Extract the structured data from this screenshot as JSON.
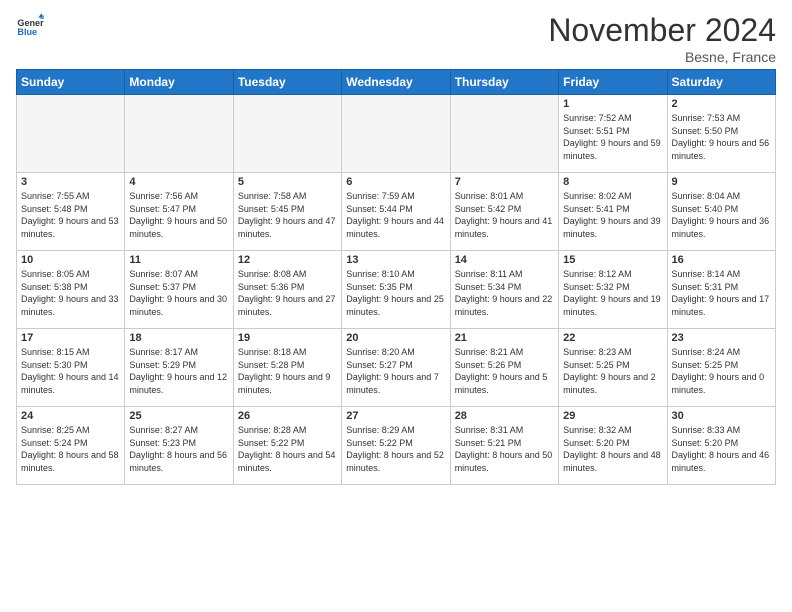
{
  "header": {
    "logo_line1": "General",
    "logo_line2": "Blue",
    "month_title": "November 2024",
    "location": "Besne, France"
  },
  "days_of_week": [
    "Sunday",
    "Monday",
    "Tuesday",
    "Wednesday",
    "Thursday",
    "Friday",
    "Saturday"
  ],
  "weeks": [
    [
      {
        "day": "",
        "empty": true
      },
      {
        "day": "",
        "empty": true
      },
      {
        "day": "",
        "empty": true
      },
      {
        "day": "",
        "empty": true
      },
      {
        "day": "",
        "empty": true
      },
      {
        "day": "1",
        "info": "Sunrise: 7:52 AM\nSunset: 5:51 PM\nDaylight: 9 hours and 59 minutes."
      },
      {
        "day": "2",
        "info": "Sunrise: 7:53 AM\nSunset: 5:50 PM\nDaylight: 9 hours and 56 minutes."
      }
    ],
    [
      {
        "day": "3",
        "info": "Sunrise: 7:55 AM\nSunset: 5:48 PM\nDaylight: 9 hours and 53 minutes."
      },
      {
        "day": "4",
        "info": "Sunrise: 7:56 AM\nSunset: 5:47 PM\nDaylight: 9 hours and 50 minutes."
      },
      {
        "day": "5",
        "info": "Sunrise: 7:58 AM\nSunset: 5:45 PM\nDaylight: 9 hours and 47 minutes."
      },
      {
        "day": "6",
        "info": "Sunrise: 7:59 AM\nSunset: 5:44 PM\nDaylight: 9 hours and 44 minutes."
      },
      {
        "day": "7",
        "info": "Sunrise: 8:01 AM\nSunset: 5:42 PM\nDaylight: 9 hours and 41 minutes."
      },
      {
        "day": "8",
        "info": "Sunrise: 8:02 AM\nSunset: 5:41 PM\nDaylight: 9 hours and 39 minutes."
      },
      {
        "day": "9",
        "info": "Sunrise: 8:04 AM\nSunset: 5:40 PM\nDaylight: 9 hours and 36 minutes."
      }
    ],
    [
      {
        "day": "10",
        "info": "Sunrise: 8:05 AM\nSunset: 5:38 PM\nDaylight: 9 hours and 33 minutes."
      },
      {
        "day": "11",
        "info": "Sunrise: 8:07 AM\nSunset: 5:37 PM\nDaylight: 9 hours and 30 minutes."
      },
      {
        "day": "12",
        "info": "Sunrise: 8:08 AM\nSunset: 5:36 PM\nDaylight: 9 hours and 27 minutes."
      },
      {
        "day": "13",
        "info": "Sunrise: 8:10 AM\nSunset: 5:35 PM\nDaylight: 9 hours and 25 minutes."
      },
      {
        "day": "14",
        "info": "Sunrise: 8:11 AM\nSunset: 5:34 PM\nDaylight: 9 hours and 22 minutes."
      },
      {
        "day": "15",
        "info": "Sunrise: 8:12 AM\nSunset: 5:32 PM\nDaylight: 9 hours and 19 minutes."
      },
      {
        "day": "16",
        "info": "Sunrise: 8:14 AM\nSunset: 5:31 PM\nDaylight: 9 hours and 17 minutes."
      }
    ],
    [
      {
        "day": "17",
        "info": "Sunrise: 8:15 AM\nSunset: 5:30 PM\nDaylight: 9 hours and 14 minutes."
      },
      {
        "day": "18",
        "info": "Sunrise: 8:17 AM\nSunset: 5:29 PM\nDaylight: 9 hours and 12 minutes."
      },
      {
        "day": "19",
        "info": "Sunrise: 8:18 AM\nSunset: 5:28 PM\nDaylight: 9 hours and 9 minutes."
      },
      {
        "day": "20",
        "info": "Sunrise: 8:20 AM\nSunset: 5:27 PM\nDaylight: 9 hours and 7 minutes."
      },
      {
        "day": "21",
        "info": "Sunrise: 8:21 AM\nSunset: 5:26 PM\nDaylight: 9 hours and 5 minutes."
      },
      {
        "day": "22",
        "info": "Sunrise: 8:23 AM\nSunset: 5:25 PM\nDaylight: 9 hours and 2 minutes."
      },
      {
        "day": "23",
        "info": "Sunrise: 8:24 AM\nSunset: 5:25 PM\nDaylight: 9 hours and 0 minutes."
      }
    ],
    [
      {
        "day": "24",
        "info": "Sunrise: 8:25 AM\nSunset: 5:24 PM\nDaylight: 8 hours and 58 minutes."
      },
      {
        "day": "25",
        "info": "Sunrise: 8:27 AM\nSunset: 5:23 PM\nDaylight: 8 hours and 56 minutes."
      },
      {
        "day": "26",
        "info": "Sunrise: 8:28 AM\nSunset: 5:22 PM\nDaylight: 8 hours and 54 minutes."
      },
      {
        "day": "27",
        "info": "Sunrise: 8:29 AM\nSunset: 5:22 PM\nDaylight: 8 hours and 52 minutes."
      },
      {
        "day": "28",
        "info": "Sunrise: 8:31 AM\nSunset: 5:21 PM\nDaylight: 8 hours and 50 minutes."
      },
      {
        "day": "29",
        "info": "Sunrise: 8:32 AM\nSunset: 5:20 PM\nDaylight: 8 hours and 48 minutes."
      },
      {
        "day": "30",
        "info": "Sunrise: 8:33 AM\nSunset: 5:20 PM\nDaylight: 8 hours and 46 minutes."
      }
    ]
  ]
}
